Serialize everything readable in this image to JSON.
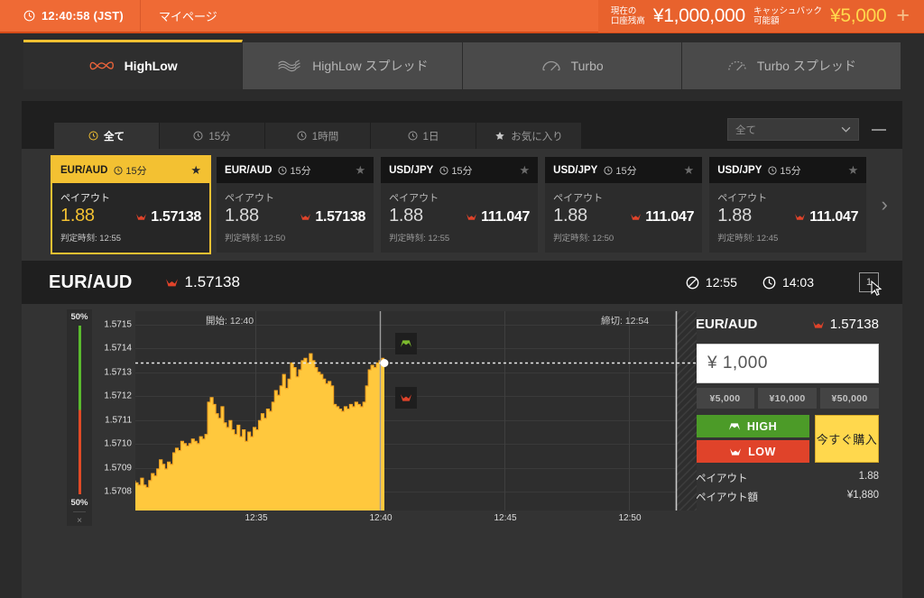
{
  "topbar": {
    "clock_icon": "clock-icon",
    "time": "12:40:58 (JST)",
    "mypage": "マイページ",
    "balance_label_line1": "現在の",
    "balance_label_line2": "口座残高",
    "balance": "¥1,000,000",
    "cashback_label_line1": "キャッシュバック",
    "cashback_label_line2": "可能額",
    "cashback": "¥5,000",
    "plus": "+",
    "bg_color": "#ef6a35",
    "cashback_color": "#ffd84d"
  },
  "tabs": [
    {
      "label": "HighLow",
      "icon": "highlow-icon",
      "active": true
    },
    {
      "label": "HighLow スプレッド",
      "icon": "highlow-spread-icon",
      "active": false
    },
    {
      "label": "Turbo",
      "icon": "turbo-icon",
      "active": false
    },
    {
      "label": "Turbo スプレッド",
      "icon": "turbo-spread-icon",
      "active": false
    }
  ],
  "filters": {
    "segments": [
      {
        "label": "全て",
        "icon": "clock-icon",
        "active": true
      },
      {
        "label": "15分",
        "icon": "clock-icon",
        "active": false
      },
      {
        "label": "1時間",
        "icon": "clock-icon",
        "active": false
      },
      {
        "label": "1日",
        "icon": "clock-icon",
        "active": false
      },
      {
        "label": "お気に入り",
        "icon": "star-icon",
        "active": false
      }
    ],
    "select_value": "全て",
    "chevron": "chevron-down-icon",
    "collapse": "minus-icon"
  },
  "cards": [
    {
      "pair": "EUR/AUD",
      "duration": "15分",
      "payout_label": "ペイアウト",
      "payout": "1.88",
      "rate": "1.57138",
      "judge": "判定時刻: 12:55",
      "selected": true
    },
    {
      "pair": "EUR/AUD",
      "duration": "15分",
      "payout_label": "ペイアウト",
      "payout": "1.88",
      "rate": "1.57138",
      "judge": "判定時刻: 12:50",
      "selected": false
    },
    {
      "pair": "USD/JPY",
      "duration": "15分",
      "payout_label": "ペイアウト",
      "payout": "1.88",
      "rate": "111.047",
      "judge": "判定時刻: 12:55",
      "selected": false
    },
    {
      "pair": "USD/JPY",
      "duration": "15分",
      "payout_label": "ペイアウト",
      "payout": "1.88",
      "rate": "111.047",
      "judge": "判定時刻: 12:50",
      "selected": false
    },
    {
      "pair": "USD/JPY",
      "duration": "15分",
      "payout_label": "ペイアウト",
      "payout": "1.88",
      "rate": "111.047",
      "judge": "判定時刻: 12:45",
      "selected": false
    }
  ],
  "cards_next_arrow": "›",
  "titlebar": {
    "pair": "EUR/AUD",
    "rate": "1.57138",
    "deadline_icon": "no-entry-icon",
    "deadline": "12:55",
    "clock_icon": "clock-icon",
    "current_time": "14:03",
    "chart_count": "1"
  },
  "sentiment": {
    "high_percent": "50%",
    "low_percent": "50%",
    "close": "×",
    "high_color": "#5aba2e",
    "low_color": "#e04a26"
  },
  "panel": {
    "pair": "EUR/AUD",
    "rate": "1.57138",
    "amount": "¥ 1,000",
    "quick_amounts": [
      "¥5,000",
      "¥10,000",
      "¥50,000"
    ],
    "high_label": "HIGH",
    "low_label": "LOW",
    "buy_label": "今すぐ購入",
    "payout_label": "ペイアウト",
    "payout_value": "1.88",
    "payout_amount_label": "ペイアウト額",
    "payout_amount_value": "¥1,880",
    "high_color": "#4c9b28",
    "low_color": "#e0432a",
    "buy_color": "#ffd84d"
  },
  "chart_data": {
    "type": "area",
    "title": "EUR/AUD",
    "xlabel": "",
    "ylabel": "",
    "series_color": "#ffc83d",
    "grid": true,
    "ytick_labels": [
      "1.5715",
      "1.5714",
      "1.5713",
      "1.5712",
      "1.5711",
      "1.5710",
      "1.5709",
      "1.5708"
    ],
    "ylim": [
      1.57072,
      1.571585
    ],
    "xtick_labels": [
      "12:35",
      "12:40",
      "12:45",
      "12:50"
    ],
    "xlim": [
      "12:32",
      "12:54"
    ],
    "annotations": [
      {
        "text": "開始: 12:40",
        "kind": "start-line",
        "time": "12:40"
      },
      {
        "text": "締切: 12:54",
        "kind": "deadline-line",
        "time": "12:54"
      }
    ],
    "current_price": 1.57138,
    "current_price_line": "dotted",
    "high_marker": "HIGH",
    "low_marker": "LOW",
    "x": [
      0,
      1,
      2,
      3,
      4,
      5,
      6,
      7,
      8,
      9,
      10,
      11,
      12,
      13,
      14,
      15,
      16,
      17,
      18,
      19,
      20,
      21,
      22,
      23,
      24,
      25,
      26,
      27,
      28,
      29,
      30,
      31,
      32,
      33,
      34,
      35,
      36,
      37,
      38,
      39,
      40,
      41,
      42,
      43,
      44,
      45,
      46,
      47,
      48,
      49,
      50,
      51,
      52,
      53,
      54,
      55,
      56,
      57,
      58,
      59,
      60,
      61,
      62,
      63,
      64,
      65,
      66,
      67,
      68,
      69,
      70,
      71,
      72,
      73,
      74,
      75,
      76,
      77,
      78,
      79,
      80,
      81,
      82,
      83,
      84,
      85,
      86,
      87,
      88,
      89,
      90,
      91,
      92,
      93
    ],
    "values": [
      1.57085,
      1.57084,
      1.57083,
      1.57086,
      1.57083,
      1.57082,
      1.57085,
      1.57088,
      1.57087,
      1.5709,
      1.57094,
      1.57092,
      1.5709,
      1.57093,
      1.57092,
      1.57097,
      1.57099,
      1.57098,
      1.57102,
      1.57101,
      1.571,
      1.57101,
      1.57103,
      1.57102,
      1.57101,
      1.57104,
      1.57103,
      1.57105,
      1.57119,
      1.57121,
      1.57118,
      1.57114,
      1.57112,
      1.57117,
      1.5711,
      1.57108,
      1.57111,
      1.57107,
      1.57105,
      1.57109,
      1.57104,
      1.57107,
      1.57102,
      1.57106,
      1.57104,
      1.57108,
      1.57107,
      1.57111,
      1.57114,
      1.57112,
      1.57116,
      1.57115,
      1.57119,
      1.57124,
      1.57122,
      1.57126,
      1.57131,
      1.57125,
      1.57129,
      1.57136,
      1.57134,
      1.5713,
      1.57133,
      1.57137,
      1.57138,
      1.57136,
      1.5714,
      1.57137,
      1.57134,
      1.57132,
      1.57131,
      1.57129,
      1.57127,
      1.57128,
      1.57126,
      1.57118,
      1.57117,
      1.57116,
      1.57115,
      1.57117,
      1.57116,
      1.57118,
      1.57117,
      1.57119,
      1.57118,
      1.57117,
      1.57119,
      1.57126,
      1.57133,
      1.57135,
      1.57134,
      1.57136,
      1.57137,
      1.57138
    ]
  }
}
